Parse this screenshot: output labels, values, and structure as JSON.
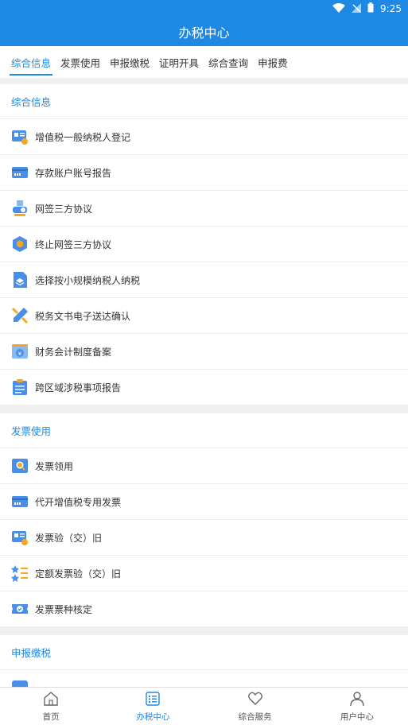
{
  "status": {
    "time": "9:25"
  },
  "app": {
    "title": "办税中心"
  },
  "tabs": [
    {
      "label": "综合信息",
      "active": true
    },
    {
      "label": "发票使用"
    },
    {
      "label": "申报缴税"
    },
    {
      "label": "证明开具"
    },
    {
      "label": "综合查询"
    },
    {
      "label": "申报费"
    }
  ],
  "sections": [
    {
      "title": "综合信息",
      "items": [
        {
          "label": "增值税一般纳税人登记",
          "icon": "doc-card-icon"
        },
        {
          "label": "存款账户账号报告",
          "icon": "bank-card-icon"
        },
        {
          "label": "网签三方协议",
          "icon": "agreement-icon"
        },
        {
          "label": "终止网签三方协议",
          "icon": "cube-icon"
        },
        {
          "label": "选择按小规模纳税人纳税",
          "icon": "layers-icon"
        },
        {
          "label": "税务文书电子送达确认",
          "icon": "pencil-icon"
        },
        {
          "label": "财务会计制度备案",
          "icon": "finance-icon"
        },
        {
          "label": "跨区域涉税事项报告",
          "icon": "clipboard-icon"
        }
      ]
    },
    {
      "title": "发票使用",
      "items": [
        {
          "label": "发票领用",
          "icon": "invoice-search-icon"
        },
        {
          "label": "代开增值税专用发票",
          "icon": "bank-card-icon"
        },
        {
          "label": "发票验（交）旧",
          "icon": "doc-card-icon"
        },
        {
          "label": "定额发票验（交）旧",
          "icon": "star-list-icon"
        },
        {
          "label": "发票票种核定",
          "icon": "ticket-check-icon"
        }
      ]
    },
    {
      "title": "申报缴税",
      "items": [
        {
          "label": "",
          "icon": "tax-icon"
        }
      ]
    }
  ],
  "bottom_nav": [
    {
      "label": "首页",
      "icon": "home-icon"
    },
    {
      "label": "办税中心",
      "icon": "list-icon",
      "active": true
    },
    {
      "label": "综合服务",
      "icon": "heart-icon"
    },
    {
      "label": "用户中心",
      "icon": "user-icon"
    }
  ]
}
